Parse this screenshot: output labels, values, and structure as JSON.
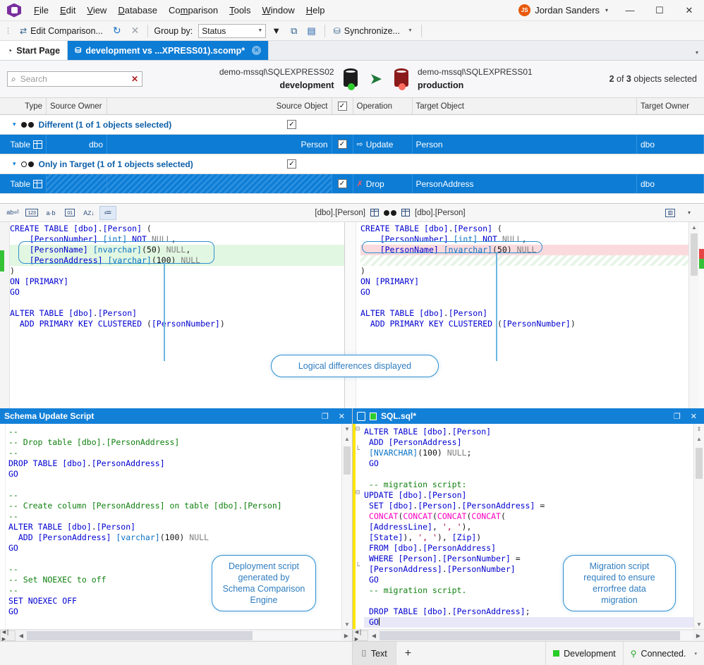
{
  "menu": {
    "items": [
      "File",
      "Edit",
      "View",
      "Database",
      "Comparison",
      "Tools",
      "Window",
      "Help"
    ],
    "user": {
      "initials": "JS",
      "name": "Jordan Sanders"
    },
    "window_buttons": {
      "minimize": "—",
      "maximize": "☐",
      "close": "✕"
    }
  },
  "toolbar": {
    "edit_comparison": "Edit Comparison...",
    "refresh_icon": "refresh-icon",
    "stop_icon": "stop-icon",
    "group_by_label": "Group by:",
    "group_by_value": "Status",
    "filter_icon": "filter-icon",
    "compare_icon": "compare-icon",
    "report_icon": "report-icon",
    "synchronize": "Synchronize...",
    "synchronize_caret": "▾"
  },
  "tabs": [
    {
      "label": "Start Page",
      "icon": "start-page-icon",
      "active": false,
      "closable": false
    },
    {
      "label": "development vs ...XPRESS01).scomp*",
      "icon": "comparison-icon",
      "active": true,
      "closable": true
    }
  ],
  "tab_overflow": "▾",
  "comparison_header": {
    "search_placeholder": "Search",
    "search_value": "",
    "search_clear": "✕",
    "source": {
      "server": "demo-mssql\\SQLEXPRESS02",
      "database": "development",
      "color": "#1d1d1d",
      "status_color": "#2ecc2e"
    },
    "target": {
      "server": "demo-mssql\\SQLEXPRESS01",
      "database": "production",
      "color": "#8b1a1a",
      "status_color": "#ff6b5e"
    },
    "arrow": "➤",
    "selection_count": {
      "selected": "2",
      "of": "of",
      "total": "3",
      "suffix": "objects selected"
    }
  },
  "grid": {
    "columns": [
      "Type",
      "Source Owner",
      "Source Object",
      "",
      "Operation",
      "Target Object",
      "Target Owner"
    ],
    "header_checkbox": "✓",
    "rows": [
      {
        "kind": "group",
        "expander": "▾",
        "dots": "filled-filled",
        "label": "Different (1 of 1 objects selected)",
        "checked": "✓"
      },
      {
        "kind": "object",
        "selected": true,
        "type": "Table",
        "source_owner": "dbo",
        "source_object": "Person",
        "checked": "✓",
        "operation": "Update",
        "operation_icon": "update-arrow-icon",
        "target_object": "Person",
        "target_owner": "dbo"
      },
      {
        "kind": "group",
        "expander": "▾",
        "dots": "empty-filled",
        "label": "Only in Target (1 of 1 objects selected)",
        "checked": "✓"
      },
      {
        "kind": "object",
        "selected": true,
        "type": "Table",
        "source_owner": "",
        "source_object": "",
        "checked": "✓",
        "operation": "Drop",
        "operation_icon": "drop-x-icon",
        "target_object": "PersonAddress",
        "target_owner": "dbo"
      }
    ]
  },
  "diff_toolbar": {
    "buttons": [
      {
        "name": "ignore-case-icon",
        "glyph": "ab"
      },
      {
        "name": "show-numbers-icon",
        "glyph": "123"
      },
      {
        "name": "whitespace-icon",
        "glyph": "a·b"
      },
      {
        "name": "hex-icon",
        "glyph": "01"
      },
      {
        "name": "sort-icon",
        "glyph": "AZ"
      },
      {
        "name": "indent-icon",
        "glyph": "≔",
        "active": true
      }
    ],
    "source_object": "[dbo].[Person]",
    "target_object": "[dbo].[Person]",
    "grid-view-icon": "grid-view-icon",
    "overflow": "▾"
  },
  "diff": {
    "left_lines": [
      {
        "t": "CREATE TABLE [dbo].[Person] ("
      },
      {
        "t": "    [PersonNumber] [int] NOT NULL,"
      },
      {
        "t": "    [PersonName] [nvarchar](50) NULL,",
        "hl": "green"
      },
      {
        "t": "    [PersonAddress] [varchar](100) NULL",
        "hl": "green"
      },
      {
        "t": ")"
      },
      {
        "t": "ON [PRIMARY]"
      },
      {
        "t": "GO"
      },
      {
        "t": ""
      },
      {
        "t": "ALTER TABLE [dbo].[Person]"
      },
      {
        "t": "  ADD PRIMARY KEY CLUSTERED ([PersonNumber])"
      }
    ],
    "right_lines": [
      {
        "t": "CREATE TABLE [dbo].[Person] ("
      },
      {
        "t": "    [PersonNumber] [int] NOT NULL,"
      },
      {
        "t": "    [PersonName] [nvarchar](50) NULL",
        "hl": "pink"
      },
      {
        "t": "",
        "hl": "hatch"
      },
      {
        "t": ")"
      },
      {
        "t": "ON [PRIMARY]"
      },
      {
        "t": "GO"
      },
      {
        "t": ""
      },
      {
        "t": "ALTER TABLE [dbo].[Person]"
      },
      {
        "t": "  ADD PRIMARY KEY CLUSTERED ([PersonNumber])"
      }
    ],
    "callout": "Logical differences displayed"
  },
  "schema_update_panel": {
    "title": "Schema Update Script",
    "restore_icon": "restore-icon",
    "close_icon": "close-icon",
    "lines": [
      "--",
      "-- Drop table [dbo].[PersonAddress]",
      "--",
      "DROP TABLE [dbo].[PersonAddress]",
      "GO",
      "",
      "--",
      "-- Create column [PersonAddress] on table [dbo].[Person]",
      "--",
      "ALTER TABLE [dbo].[Person]",
      "  ADD [PersonAddress] [varchar](100) NULL",
      "GO",
      "",
      "--",
      "-- Set NOEXEC to off",
      "--",
      "SET NOEXEC OFF",
      "GO"
    ],
    "callout": "Deployment script generated by Schema Comparison Engine"
  },
  "sql_panel": {
    "title": "SQL.sql*",
    "file_icon": "sql-file-icon",
    "status_icon": "green-square-icon",
    "restore_icon": "restore-icon",
    "close_icon": "close-icon",
    "lines": [
      "ALTER TABLE [dbo].[Person]",
      " ADD [PersonAddress]",
      " [NVARCHAR](100) NULL;",
      " GO",
      "",
      " -- migration script:",
      "UPDATE [dbo].[Person]",
      " SET [dbo].[Person].[PersonAddress] =",
      " CONCAT(CONCAT(CONCAT(CONCAT(",
      " [AddressLine], ', '),",
      " [State]), ', '), [Zip])",
      " FROM [dbo].[PersonAddress]",
      " WHERE [Person].[PersonNumber] =",
      " [PersonAddress].[PersonNumber]",
      " GO",
      " -- migration script.",
      "",
      " DROP TABLE [dbo].[PersonAddress];",
      " GO"
    ],
    "callout": "Migration script required to ensure errorfree data migration"
  },
  "statusbar": {
    "text_tab": "Text",
    "text_tab_icon": "text-tab-icon",
    "add_tab": "+",
    "environment": "Development",
    "environment_color": "#27cc27",
    "connection": "Connected.",
    "connection_icon": "plug-icon",
    "connection_caret": "▾"
  },
  "scrollbars": {
    "left_arrow": "◀",
    "right_arrow": "▶",
    "up_arrow": "▲",
    "down_arrow": "▼",
    "split_icon": "split-icon"
  }
}
